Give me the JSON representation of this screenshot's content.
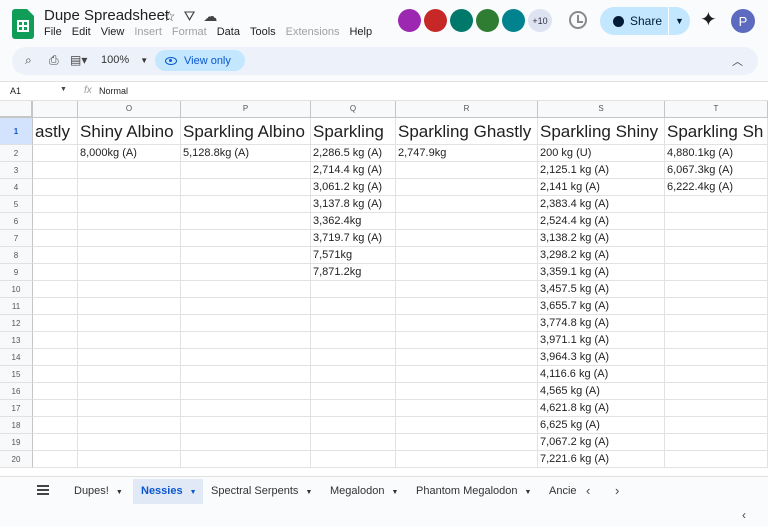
{
  "app": {
    "doc_title": "Dupe Spreadsheet",
    "menu": [
      "File",
      "Edit",
      "View",
      "Insert",
      "Format",
      "Data",
      "Tools",
      "Extensions",
      "Help"
    ],
    "menu_disabled": [
      false,
      false,
      false,
      true,
      true,
      false,
      false,
      true,
      false
    ],
    "more_collaborators": "+10",
    "share_label": "Share",
    "profile_initial": "P",
    "collaborator_colors": [
      "#9c27b0",
      "#c62828",
      "#00796b",
      "#2e7d32",
      "#00838f"
    ]
  },
  "toolbar": {
    "zoom": "100%",
    "view_only_label": "View only"
  },
  "formula_bar": {
    "cell_ref": "A1",
    "fx": "fx",
    "value": "Normal"
  },
  "grid": {
    "columns": [
      "O",
      "P",
      "Q",
      "R",
      "S",
      "T"
    ],
    "row_numbers": [
      "1",
      "2",
      "3",
      "4",
      "5",
      "6",
      "7",
      "8",
      "9",
      "10",
      "11",
      "12",
      "13",
      "14",
      "15",
      "16",
      "17",
      "18",
      "19",
      "20"
    ],
    "headers": [
      "astly",
      "Shiny Albino",
      "Sparkling Albino",
      "Sparkling",
      "Sparkling Ghastly",
      "Sparkling Shiny",
      "Sparkling Sh"
    ],
    "col_n": [
      "",
      "",
      "",
      "",
      "",
      "",
      "",
      "",
      "",
      "",
      "",
      "",
      "",
      "",
      "",
      "",
      "",
      "",
      ""
    ],
    "col_o": [
      "8,000kg (A)",
      "",
      "",
      "",
      "",
      "",
      "",
      "",
      "",
      "",
      "",
      "",
      "",
      "",
      "",
      "",
      "",
      "",
      ""
    ],
    "col_p": [
      "5,128.8kg (A)",
      "",
      "",
      "",
      "",
      "",
      "",
      "",
      "",
      "",
      "",
      "",
      "",
      "",
      "",
      "",
      "",
      "",
      ""
    ],
    "col_q": [
      "2,286.5 kg (A)",
      "2,714.4 kg (A)",
      "3,061.2 kg (A)",
      "3,137.8 kg (A)",
      "3,362.4kg",
      "3,719.7 kg (A)",
      "7,571kg",
      "7,871.2kg",
      "",
      "",
      "",
      "",
      "",
      "",
      "",
      "",
      "",
      "",
      ""
    ],
    "col_r": [
      "2,747.9kg",
      "",
      "",
      "",
      "",
      "",
      "",
      "",
      "",
      "",
      "",
      "",
      "",
      "",
      "",
      "",
      "",
      "",
      ""
    ],
    "col_s": [
      "200 kg (U)",
      "2,125.1 kg (A)",
      "2,141 kg (A)",
      "2,383.4 kg (A)",
      "2,524.4 kg (A)",
      "3,138.2 kg (A)",
      "3,298.2 kg (A)",
      "3,359.1 kg (A)",
      "3,457.5 kg (A)",
      "3,655.7 kg (A)",
      "3,774.8 kg (A)",
      "3,971.1 kg (A)",
      "3,964.3 kg (A)",
      "4,116.6 kg (A)",
      "4,565 kg (A)",
      "4,621.8 kg (A)",
      "6,625 kg (A)",
      "7,067.2 kg (A)",
      "7,221.6 kg (A)"
    ],
    "col_t": [
      "4,880.1kg (A)",
      "6,067.3kg (A)",
      "6,222.4kg (A)",
      "",
      "",
      "",
      "",
      "",
      "",
      "",
      "",
      "",
      "",
      "",
      "",
      "",
      "",
      "",
      ""
    ]
  },
  "tabs": [
    {
      "label": "Dupes!",
      "active": false
    },
    {
      "label": "Nessies",
      "active": true
    },
    {
      "label": "Spectral Serpents",
      "active": false
    },
    {
      "label": "Megalodon",
      "active": false
    },
    {
      "label": "Phantom Megalodon",
      "active": false
    },
    {
      "label": "Ancie",
      "active": false
    }
  ]
}
